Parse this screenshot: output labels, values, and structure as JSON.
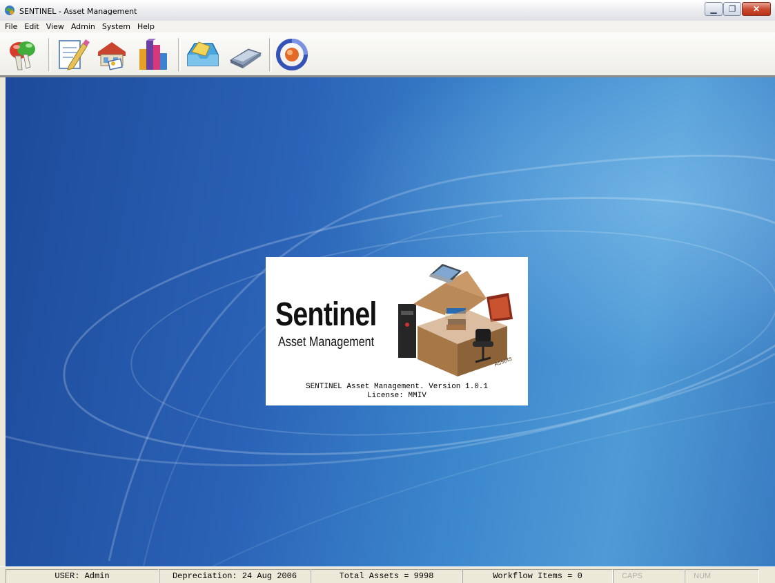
{
  "window": {
    "title": "SENTINEL - Asset Management"
  },
  "menu": [
    "File",
    "Edit",
    "View",
    "Admin",
    "System",
    "Help"
  ],
  "toolbar": {
    "buttons": [
      {
        "icon": "security-icon"
      },
      {
        "icon": "edit-document-icon"
      },
      {
        "icon": "assets-icon"
      },
      {
        "icon": "reports-chart-icon"
      },
      {
        "icon": "workflow-inbox-icon"
      },
      {
        "icon": "scanner-icon"
      },
      {
        "icon": "exit-icon"
      }
    ]
  },
  "splash": {
    "title": "Sentinel",
    "subtitle": "Asset Management",
    "box_label": "Assets",
    "line1": "SENTINEL Asset Management.  Version 1.0.1",
    "line2": "License: MMIV"
  },
  "status": {
    "user": "USER: Admin",
    "depreciation": "Depreciation: 24 Aug 2006",
    "total_assets": "Total Assets = 9998",
    "workflow": "Workflow Items = 0",
    "caps": "CAPS",
    "num": "NUM"
  },
  "colors": {
    "desktop_blue": "#2a62b6",
    "close_button": "#c9472d"
  }
}
